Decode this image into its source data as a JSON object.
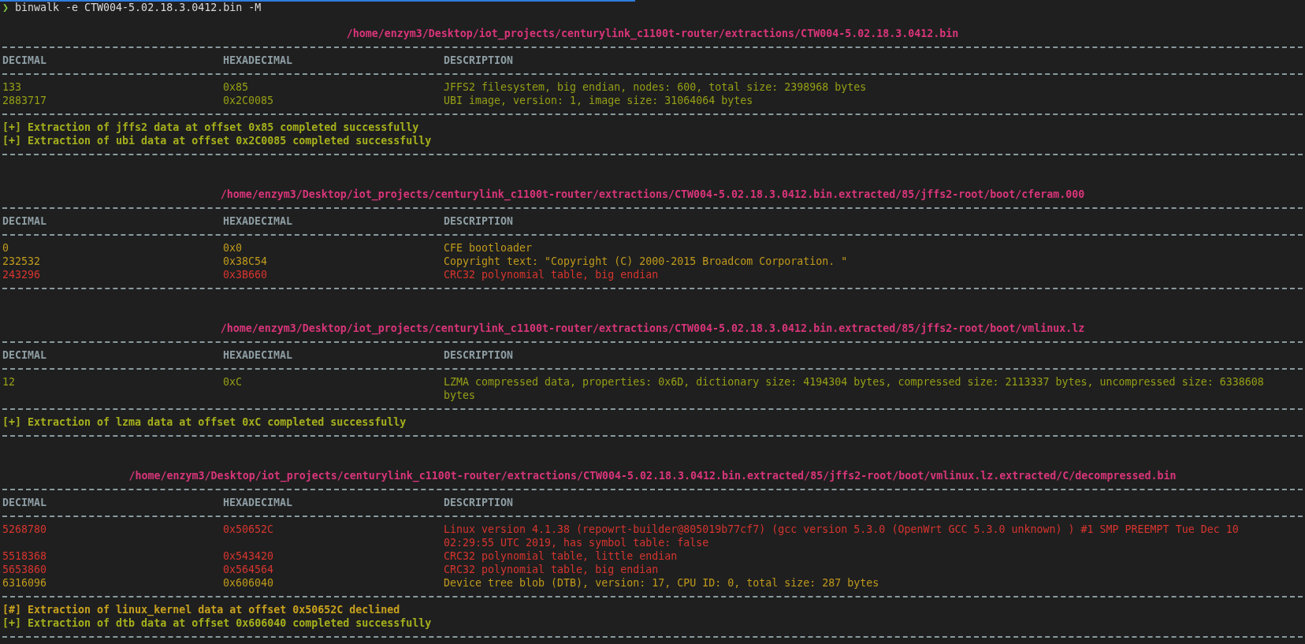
{
  "prompt": {
    "symbol": "❯",
    "command": "binwalk -e CTW004-5.02.18.3.0412.bin -M"
  },
  "sections": [
    {
      "path": "/home/enzym3/Desktop/iot_projects/centurylink_c1100t-router/extractions/CTW004-5.02.18.3.0412.bin",
      "columns": [
        "DECIMAL",
        "HEXADECIMAL",
        "DESCRIPTION"
      ],
      "rows": [
        {
          "decimal": "133",
          "hexadecimal": "0x85",
          "description": "JFFS2 filesystem, big endian, nodes: 600, total size: 2398968 bytes",
          "color": "#959f16"
        },
        {
          "decimal": "2883717",
          "hexadecimal": "0x2C0085",
          "description": "UBI image, version: 1, image size: 31064064 bytes",
          "color": "#959f16"
        }
      ],
      "messages": [
        {
          "text": "[+] Extraction of jffs2 data at offset 0x85 completed successfully",
          "color": "#a5b01c"
        },
        {
          "text": "[+] Extraction of ubi data at offset 0x2C0085 completed successfully",
          "color": "#a5b01c"
        }
      ]
    },
    {
      "path": "/home/enzym3/Desktop/iot_projects/centurylink_c1100t-router/extractions/CTW004-5.02.18.3.0412.bin.extracted/85/jffs2-root/boot/cferam.000",
      "columns": [
        "DECIMAL",
        "HEXADECIMAL",
        "DESCRIPTION"
      ],
      "rows": [
        {
          "decimal": "0",
          "hexadecimal": "0x0",
          "description": "CFE bootloader",
          "color": "#c09a1c"
        },
        {
          "decimal": "232532",
          "hexadecimal": "0x38C54",
          "description": "Copyright text: \"Copyright (C) 2000-2015 Broadcom Corporation. \"",
          "color": "#c09a1c"
        },
        {
          "decimal": "243296",
          "hexadecimal": "0x3B660",
          "description": "CRC32 polynomial table, big endian",
          "color": "#d6352f"
        }
      ]
    },
    {
      "path": "/home/enzym3/Desktop/iot_projects/centurylink_c1100t-router/extractions/CTW004-5.02.18.3.0412.bin.extracted/85/jffs2-root/boot/vmlinux.lz",
      "columns": [
        "DECIMAL",
        "HEXADECIMAL",
        "DESCRIPTION"
      ],
      "rows": [
        {
          "decimal": "12",
          "hexadecimal": "0xC",
          "description": "LZMA compressed data, properties: 0x6D, dictionary size: 4194304 bytes, compressed size: 2113337 bytes, uncompressed size: 6338608 bytes",
          "color": "#959f16"
        }
      ],
      "messages": [
        {
          "text": "[+] Extraction of lzma data at offset 0xC completed successfully",
          "color": "#a5b01c"
        }
      ]
    },
    {
      "path": "/home/enzym3/Desktop/iot_projects/centurylink_c1100t-router/extractions/CTW004-5.02.18.3.0412.bin.extracted/85/jffs2-root/boot/vmlinux.lz.extracted/C/decompressed.bin",
      "columns": [
        "DECIMAL",
        "HEXADECIMAL",
        "DESCRIPTION"
      ],
      "rows": [
        {
          "decimal": "5268780",
          "hexadecimal": "0x50652C",
          "description": "Linux version 4.1.38 (repowrt-builder@805019b77cf7) (gcc version 5.3.0 (OpenWrt GCC 5.3.0 unknown) ) #1 SMP PREEMPT Tue Dec 10 02:29:55 UTC 2019, has symbol table: false",
          "color": "#d6352f"
        },
        {
          "decimal": "5518368",
          "hexadecimal": "0x543420",
          "description": "CRC32 polynomial table, little endian",
          "color": "#d6352f"
        },
        {
          "decimal": "5653860",
          "hexadecimal": "0x564564",
          "description": "CRC32 polynomial table, big endian",
          "color": "#d6352f"
        },
        {
          "decimal": "6316096",
          "hexadecimal": "0x606040",
          "description": "Device tree blob (DTB), version: 17, CPU ID: 0, total size: 287 bytes",
          "color": "#c09a1c"
        }
      ],
      "messages": [
        {
          "text": "[#] Extraction of linux_kernel data at offset 0x50652C declined",
          "color": "#c9a21e"
        },
        {
          "text": "[+] Extraction of dtb data at offset 0x606040 completed successfully",
          "color": "#a5b01c"
        }
      ]
    }
  ]
}
